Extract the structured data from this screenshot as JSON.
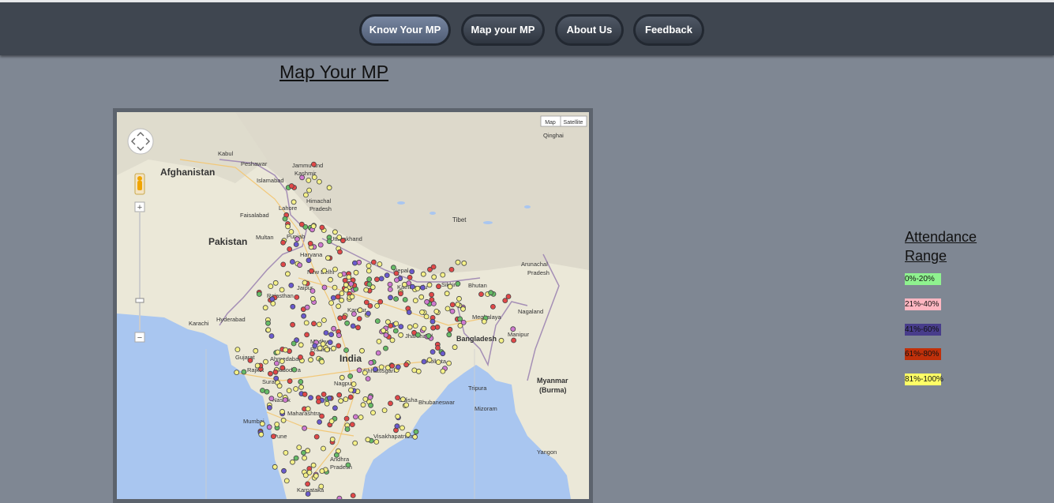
{
  "nav": {
    "items": [
      {
        "label": "Know Your MP",
        "active": true
      },
      {
        "label": "Map your MP",
        "active": false
      },
      {
        "label": "About Us",
        "active": false
      },
      {
        "label": "Feedback",
        "active": false
      }
    ]
  },
  "page_title": "Map Your MP",
  "map": {
    "type_buttons": [
      "Map",
      "Satellite"
    ],
    "labels": {
      "afghanistan": "Afghanistan",
      "pakistan": "Pakistan",
      "india": "India",
      "tibet": "Tibet",
      "bangladesh": "Bangladesh",
      "myanmar": "Myanmar",
      "burma": "(Burma)",
      "kabul": "Kabul",
      "peshawar": "Peshawar",
      "islamabad": "Islamabad",
      "faisalabad": "Faisalabad",
      "multan": "Multan",
      "karachi": "Karachi",
      "hyderabad": "Hyderabad",
      "qinghai": "Qinghai",
      "nepal": "Nepal",
      "kathmandu": "Kathmandu",
      "sikkim": "Sikkim",
      "bhutan": "Bhutan",
      "arunachal": "Arunachal",
      "pradesh": "Pradesh",
      "nagaland": "Nagaland",
      "meghalaya": "Meghalaya",
      "manipur": "Manipur",
      "tripura": "Tripura",
      "mizoram": "Mizoram",
      "jammu_and": "Jammu and",
      "kashmir": "Kashmir",
      "himachal": "Himachal",
      "himachal_pradesh": "Pradesh",
      "lahore": "Lahore",
      "punjab": "Punjab",
      "uttarakhand": "Uttarakhand",
      "haryana": "Haryana",
      "new_delhi": "New Delhi",
      "rajasthan": "Rajasthan",
      "jaipur": "Jaipur",
      "kanpur": "Kanpur",
      "madhya": "Madhya",
      "madhya_pradesh": "Pradesh",
      "gujarat": "Gujarat",
      "ahmedabad": "Ahmedabad",
      "rajkot": "Rajkot",
      "vadodara": "Vadodara",
      "surat": "Surat",
      "nagpur": "Nagpur",
      "chhattisgarh": "Chhattisgarh",
      "jharkhand": "Jharkhand",
      "kolkata": "Kolkata",
      "odisha": "Odisha",
      "bhubaneswar": "Bhubaneswar",
      "nashik": "Nashik",
      "maharashtra": "Maharashtra",
      "mumbai": "Mumbai",
      "pune": "Pune",
      "visakhapatnam": "Visakhapatnam",
      "andhra": "Andhra",
      "andhra_pradesh": "Pradesh",
      "karnataka": "Karnataka",
      "yangon": "Yangon"
    }
  },
  "legend": {
    "title": "Attendance Range",
    "items": [
      {
        "label": "0%-20%",
        "color": "#8ff28f"
      },
      {
        "label": "21%-40%",
        "color": "#ffb6c1"
      },
      {
        "label": "41%-60%",
        "color": "#483d8b"
      },
      {
        "label": "61%-80%",
        "color": "#c0300a"
      },
      {
        "label": "81%-100%",
        "color": "#ffff66"
      }
    ]
  },
  "colors": {
    "background": "#7f8793",
    "navbar": "#3f4650",
    "active_button": "#66758f",
    "marker_yellow": "#f4f088",
    "marker_red": "#e04848",
    "marker_purple": "#6a5acd",
    "marker_pink": "#d07ad0",
    "marker_green": "#66bb66"
  }
}
